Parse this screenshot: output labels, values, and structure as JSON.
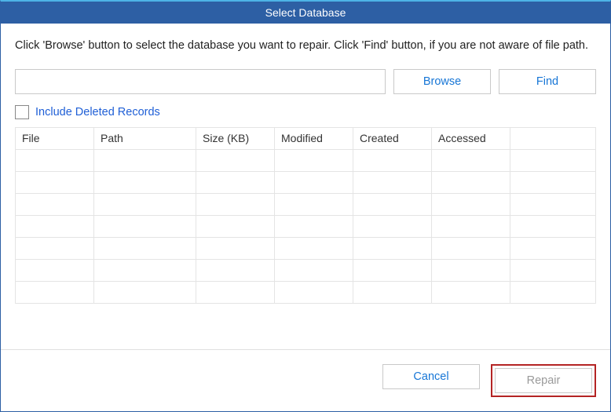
{
  "title": "Select Database",
  "instructions": "Click 'Browse' button to select the database you want to repair. Click 'Find' button, if you are not aware of file path.",
  "pathInput": {
    "value": "",
    "placeholder": ""
  },
  "buttons": {
    "browse": "Browse",
    "find": "Find",
    "cancel": "Cancel",
    "repair": "Repair"
  },
  "checkbox": {
    "label": "Include Deleted Records",
    "checked": false
  },
  "table": {
    "headers": [
      "File",
      "Path",
      "Size (KB)",
      "Modified",
      "Created",
      "Accessed",
      ""
    ],
    "rows": [
      [
        "",
        "",
        "",
        "",
        "",
        "",
        ""
      ],
      [
        "",
        "",
        "",
        "",
        "",
        "",
        ""
      ],
      [
        "",
        "",
        "",
        "",
        "",
        "",
        ""
      ],
      [
        "",
        "",
        "",
        "",
        "",
        "",
        ""
      ],
      [
        "",
        "",
        "",
        "",
        "",
        "",
        ""
      ],
      [
        "",
        "",
        "",
        "",
        "",
        "",
        ""
      ],
      [
        "",
        "",
        "",
        "",
        "",
        "",
        ""
      ]
    ]
  }
}
